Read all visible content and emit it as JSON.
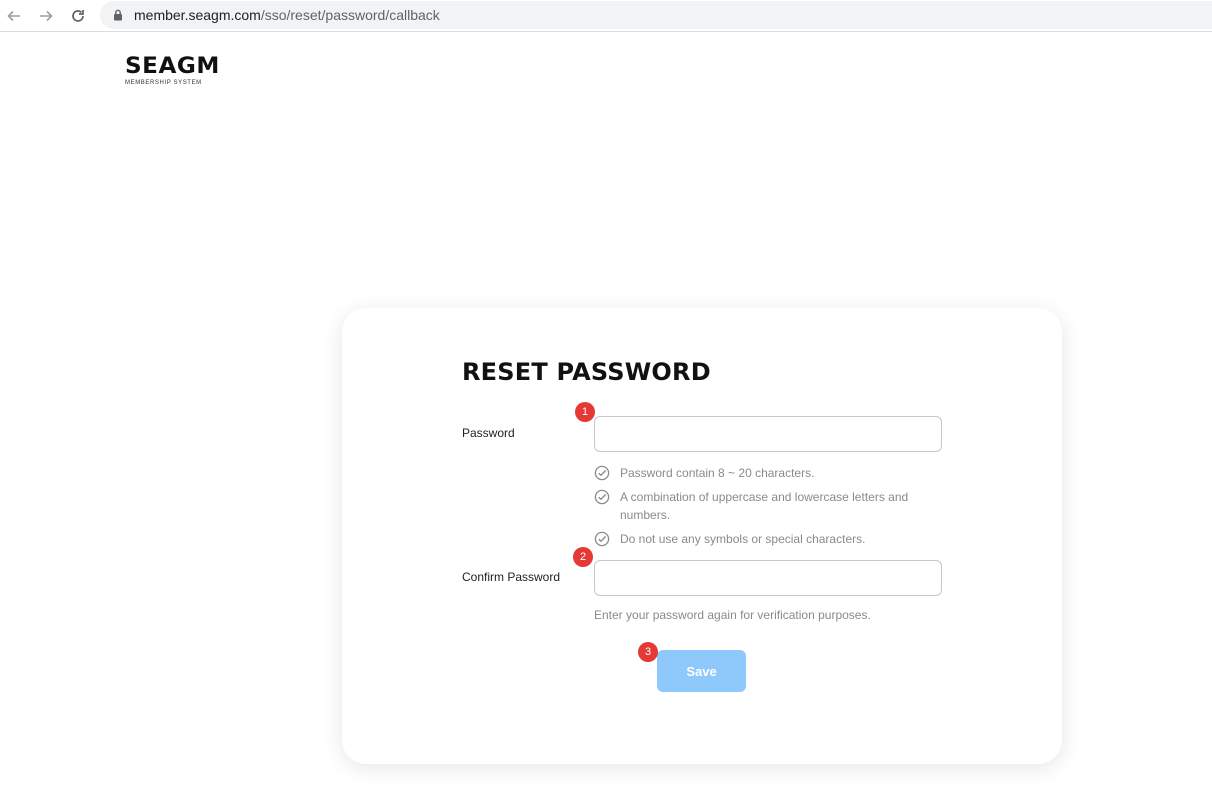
{
  "browser": {
    "url_host": "member.seagm.com",
    "url_path": "/sso/reset/password/callback"
  },
  "logo": {
    "text": "SEAGM",
    "subtitle": "MEMBERSHIP SYSTEM"
  },
  "form": {
    "title": "RESET PASSWORD",
    "password_label": "Password",
    "password_value": "",
    "confirm_label": "Confirm Password",
    "confirm_value": "",
    "rules": [
      "Password contain 8 ~ 20 characters.",
      "A combination of uppercase and lowercase letters and numbers.",
      "Do not use any symbols or special characters."
    ],
    "confirm_hint": "Enter your password again for verification purposes.",
    "save_label": "Save"
  },
  "annotations": {
    "badge_1": "1",
    "badge_2": "2",
    "badge_3": "3"
  },
  "colors": {
    "save_button": "#8fc8fb",
    "badge": "#e53935",
    "hint_text": "#8a8a8a"
  },
  "icons": {
    "rule": "check-circle-icon",
    "back": "arrow-left-icon",
    "forward": "arrow-right-icon",
    "reload": "reload-icon",
    "lock": "lock-icon"
  }
}
